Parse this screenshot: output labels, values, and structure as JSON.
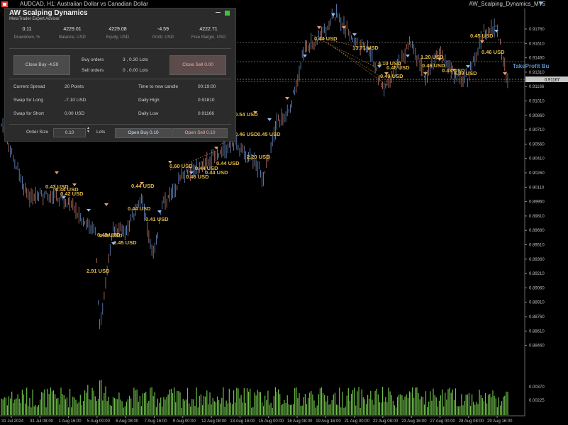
{
  "window": {
    "title": "AUDCAD, H1: Australian Dollar vs Canadian Dollar",
    "ea_label": "AW_Scalping_Dynamics_MT5"
  },
  "panel": {
    "brand": "AW Scalping Dynamics",
    "subtitle": "MetaTrader Expert Advisor",
    "summary": [
      {
        "value": "0.11",
        "label": "Drawdown, %"
      },
      {
        "value": "4229.01",
        "label": "Balance, USD"
      },
      {
        "value": "4229.08",
        "label": "Equity, USD"
      },
      {
        "value": "-4.59",
        "label": "Profit, USD"
      },
      {
        "value": "4222.71",
        "label": "Free Margin, USD"
      }
    ],
    "close_buy_label": "Close Buy -4.59",
    "close_sell_label": "Close Sell 0.00",
    "buy_orders_label": "Buy orders",
    "buy_orders_value": "3 , 0.30 Lots",
    "sell_orders_label": "Sell orders",
    "sell_orders_value": "0 , 0.00 Lots",
    "stats_left": [
      {
        "label": "Current Spread",
        "value": "20 Points"
      },
      {
        "label": "Swap for Long",
        "value": "-7.10  USD"
      },
      {
        "label": "Swap for Short",
        "value": "0.00  USD"
      }
    ],
    "stats_right": [
      {
        "label": "Time to new candle",
        "value": "00:19:00"
      },
      {
        "label": "Daily High",
        "value": "0.91810"
      },
      {
        "label": "Daily Low",
        "value": "0.91166"
      }
    ],
    "order_size_label": "Order Size",
    "order_size_value": "0.10",
    "lots_label": "Lots",
    "open_buy_label": "Open Buy 0.10",
    "open_sell_label": "Open Sell 0.10"
  },
  "price_axis": [
    "0.91760",
    "0.91610",
    "0.91460",
    "0.91310",
    "0.91166",
    "0.91010",
    "0.90860",
    "0.90710",
    "0.90560",
    "0.90410",
    "0.90260",
    "0.90110",
    "0.89960",
    "0.89810",
    "0.89660",
    "0.89510",
    "0.89360",
    "0.89210",
    "0.89060",
    "0.88910",
    "0.88760",
    "0.88610",
    "0.88460"
  ],
  "price_axis_lower": [
    "0.00370",
    "0.00225"
  ],
  "current_price": "0.91167",
  "time_axis": [
    "31 Jul 2024",
    "31 Jul 08:00",
    "1 Aug 16:00",
    "5 Aug 00:00",
    "6 Aug 08:00",
    "7 Aug 16:00",
    "9 Aug 00:00",
    "12 Aug 08:00",
    "13 Aug 16:00",
    "15 Aug 00:00",
    "16 Aug 08:00",
    "19 Aug 16:00",
    "21 Aug 00:00",
    "22 Aug 08:00",
    "23 Aug 16:00",
    "27 Aug 00:00",
    "28 Aug 08:00",
    "29 Aug 16:00"
  ],
  "annotations": [
    "0.44 USD",
    "13.71 USD",
    "0.45 USD",
    "0.46 USD",
    "1.20 USD",
    "4.10 USD",
    "0.45 USD",
    "0.49 USD",
    "0.46 USD",
    "0.43 USD",
    "4.09 USD",
    "0.54 USD",
    "0.46 USD",
    "0.45 USD",
    "2.20 USD",
    "0.60 USD",
    "0.44 USD",
    "0.44 USD",
    "0.44 USD",
    "0.46 USD",
    "0.43 USD",
    "0.44 USD",
    "0.44 USD",
    "0.44 USD",
    "0.41 USD",
    "0.42 USD",
    "2.91 USD",
    "0.48 USD",
    "0.45 USD",
    "0.43 USD"
  ],
  "takeprofit_label": "TakeProfit Bu",
  "colors": {
    "up": "#6b8fc9",
    "down": "#c47a6a",
    "volume": "#6fbf4a",
    "annotation": "#e0b84a"
  }
}
